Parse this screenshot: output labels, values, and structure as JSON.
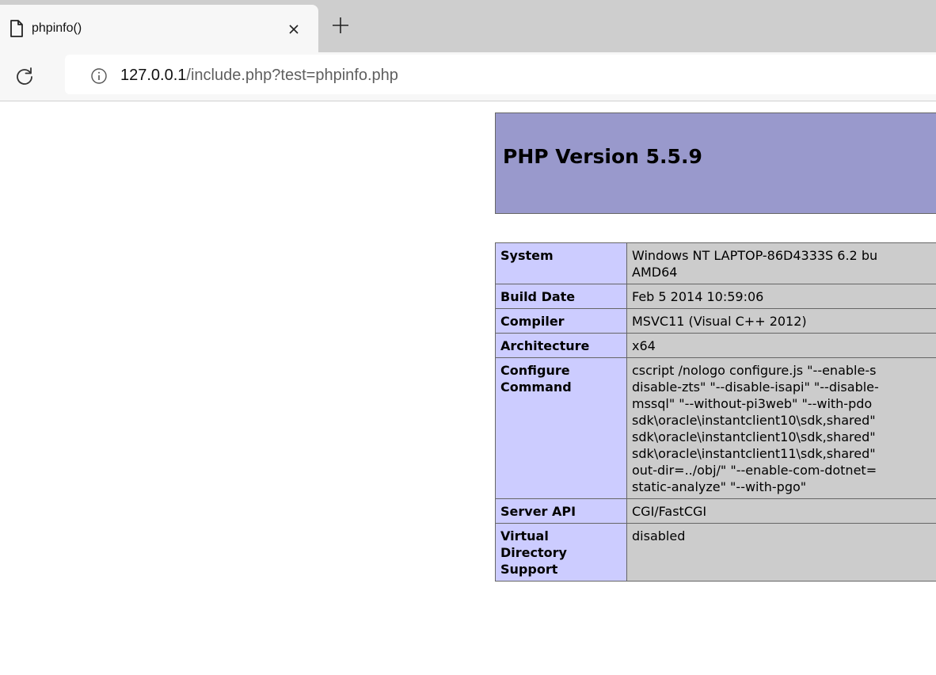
{
  "browser": {
    "tab": {
      "title": "phpinfo()",
      "close_glyph": "×",
      "icon": "file-icon"
    },
    "new_tab_glyph": "+",
    "toolbar": {
      "reload_icon": "reload-icon",
      "info_icon": "info-icon",
      "url_host": "127.0.0.1",
      "url_path": "/include.php?test=phpinfo.php"
    }
  },
  "phpinfo": {
    "version_title": "PHP Version 5.5.9",
    "rows": [
      {
        "key": "System",
        "value": "Windows NT LAPTOP-86D4333S 6.2 bu\nAMD64"
      },
      {
        "key": "Build Date",
        "value": "Feb 5 2014 10:59:06"
      },
      {
        "key": "Compiler",
        "value": "MSVC11 (Visual C++ 2012)"
      },
      {
        "key": "Architecture",
        "value": "x64"
      },
      {
        "key": "Configure\nCommand",
        "value": "cscript /nologo configure.js \"--enable-s\ndisable-zts\" \"--disable-isapi\" \"--disable-\nmssql\" \"--without-pi3web\" \"--with-pdo\nsdk\\oracle\\instantclient10\\sdk,shared\"\nsdk\\oracle\\instantclient10\\sdk,shared\"\nsdk\\oracle\\instantclient11\\sdk,shared\"\nout-dir=../obj/\" \"--enable-com-dotnet=\nstatic-analyze\" \"--with-pgo\""
      },
      {
        "key": "Server API",
        "value": "CGI/FastCGI"
      },
      {
        "key": "Virtual\nDirectory\nSupport",
        "value": "disabled"
      }
    ]
  },
  "colors": {
    "header_bg": "#9999cc",
    "key_bg": "#ccccff",
    "value_bg": "#cccccc",
    "tabstrip_bg": "#cecece"
  }
}
